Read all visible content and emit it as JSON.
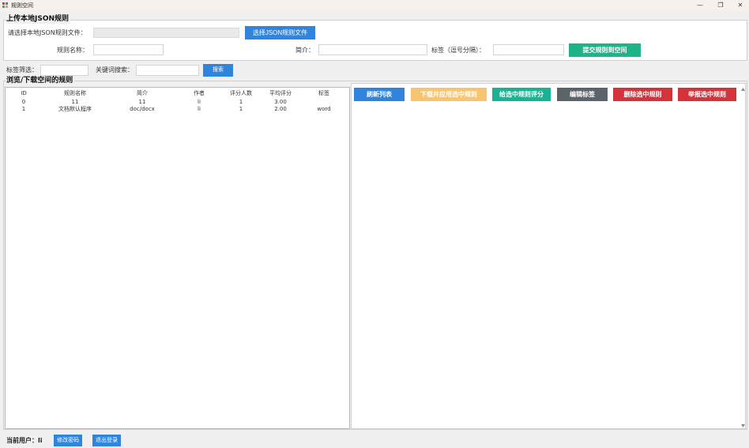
{
  "window": {
    "title": "规则空间",
    "controls": [
      "—",
      "❐",
      "✕"
    ]
  },
  "upload": {
    "group_title": "上传本地JSON规则",
    "file_label": "请选择本地JSON规则文件：",
    "file_value": "",
    "choose_button": "选择JSON规则文件",
    "name_label": "规则名称：",
    "name_value": "",
    "desc_label": "简介：",
    "desc_value": "",
    "tags_label": "标签（逗号分隔）：",
    "tags_value": "",
    "submit_button": "提交规则到空间"
  },
  "filter": {
    "tag_label": "标签筛选：",
    "tag_value": "",
    "keyword_label": "关键词搜索：",
    "keyword_value": "",
    "search_button": "搜索"
  },
  "browse": {
    "group_title": "浏览/下载空间的规则",
    "columns": [
      "ID",
      "规则名称",
      "简介",
      "作者",
      "评分人数",
      "平均评分",
      "标签"
    ],
    "rows": [
      [
        "0",
        "11",
        "11",
        "li",
        "1",
        "3.00",
        ""
      ],
      [
        "1",
        "文档默认程序",
        "doc/docx",
        "li",
        "1",
        "2.00",
        "word"
      ]
    ]
  },
  "actions": {
    "refresh": "刷新列表",
    "download": "下载并应用选中规则",
    "rate": "给选中规则评分",
    "edit_tags": "编辑标签",
    "delete": "删除选中规则",
    "report": "举报选中规则"
  },
  "status": {
    "user_label": "当前用户：li",
    "change_password": "修改密码",
    "logout": "退出登录"
  },
  "colors": {
    "primary": "#2f84de",
    "success": "#1db48a",
    "warning": "#f7c46f",
    "teal": "#19b394",
    "dark": "#5b6468",
    "danger": "#d4333b"
  },
  "icons": {
    "app": "app-logo-icon",
    "scroll_up": "scroll-up-arrow-icon",
    "scroll_down": "scroll-down-arrow-icon"
  }
}
